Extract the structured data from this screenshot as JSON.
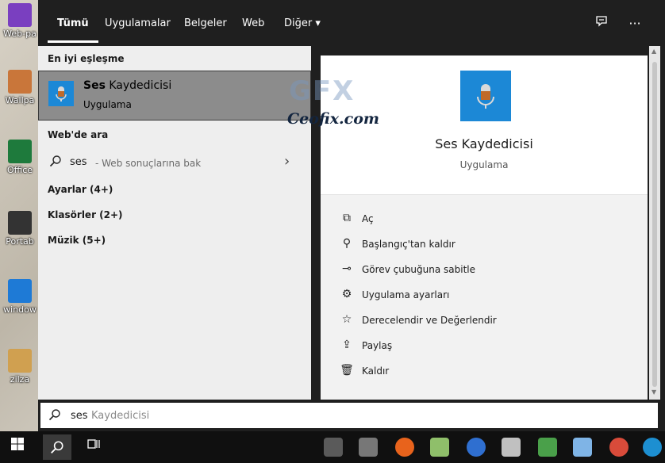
{
  "desktop": {
    "icons": [
      {
        "label": "Web-pa",
        "color": "#7a3fc0"
      },
      {
        "label": "Wallpa",
        "color": "#c9763a"
      },
      {
        "label": "Office",
        "color": "#1e7a3c"
      },
      {
        "label": "Portab",
        "color": "#333333"
      },
      {
        "label": "window",
        "color": "#1e7ad6"
      },
      {
        "label": "zilza",
        "color": "#d0a050"
      }
    ]
  },
  "tabs": [
    "Tümü",
    "Uygulamalar",
    "Belgeler",
    "Web",
    "Diğer ▾"
  ],
  "toolbar": {
    "feedback_icon": "feedback-icon",
    "more_label": "···"
  },
  "left": {
    "best_match_header": "En iyi eşleşme",
    "best_match": {
      "title_bold": "Ses",
      "title_rest": " Kaydedicisi",
      "subtitle": "Uygulama"
    },
    "web_header": "Web'de ara",
    "web_query": "ses",
    "web_hint": "- Web sonuçlarına bak",
    "web_chevron": "›",
    "categories": [
      "Ayarlar (4+)",
      "Klasörler (2+)",
      "Müzik (5+)"
    ]
  },
  "right": {
    "title": "Ses Kaydedicisi",
    "subtitle": "Uygulama",
    "actions": [
      {
        "label": "Aç",
        "icon": "open-icon",
        "glyph": "⧉"
      },
      {
        "label": "Başlangıç'tan kaldır",
        "icon": "unpin-icon",
        "glyph": "⚲"
      },
      {
        "label": "Görev çubuğuna sabitle",
        "icon": "pin-icon",
        "glyph": "⊸"
      },
      {
        "label": "Uygulama ayarları",
        "icon": "gear-icon",
        "glyph": "⚙"
      },
      {
        "label": "Derecelendir ve Değerlendir",
        "icon": "rate-icon",
        "glyph": "☆"
      },
      {
        "label": "Paylaş",
        "icon": "share-icon",
        "glyph": "⇪"
      },
      {
        "label": "Kaldır",
        "icon": "trash-icon",
        "glyph": "🗑"
      }
    ]
  },
  "watermark": {
    "logo": "GFX",
    "text": "Ceofix.com"
  },
  "search": {
    "typed": "ses",
    "suggestion": " Kaydedicisi"
  },
  "taskbar": {
    "apps": [
      {
        "name": "magnifier-app",
        "color": "#5a5a5a"
      },
      {
        "name": "headset-app",
        "color": "#777777"
      },
      {
        "name": "firefox-app",
        "color": "#e8631c"
      },
      {
        "name": "photos-app",
        "color": "#8fbf6a"
      },
      {
        "name": "media-player-app",
        "color": "#2f6fd0"
      },
      {
        "name": "calendar-app",
        "color": "#c0c0c0"
      },
      {
        "name": "image-viewer-app",
        "color": "#4aa04a"
      },
      {
        "name": "notes-app",
        "color": "#7fb4e6"
      },
      {
        "name": "chrome-app",
        "color": "#d94b3a"
      },
      {
        "name": "edge-app",
        "color": "#1d8fd1"
      }
    ]
  }
}
